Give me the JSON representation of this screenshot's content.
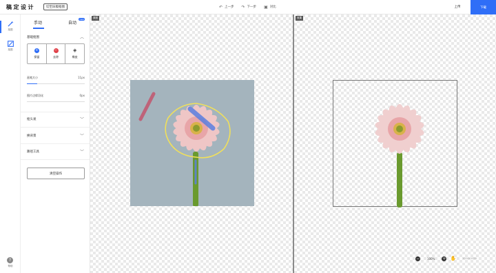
{
  "app": {
    "logo": "稿定设计",
    "switch_label": "切至旧版抠图"
  },
  "toolbar": {
    "undo": "上一步",
    "redo": "下一步",
    "compare": "对比",
    "upload": "上传",
    "download": "下载"
  },
  "rail": [
    {
      "label": "抠图",
      "icon": "magic-wand-icon"
    },
    {
      "label": "抠图",
      "icon": "image-edit-icon"
    }
  ],
  "help": {
    "label": "帮助"
  },
  "panel": {
    "tabs": [
      "手动",
      "自动"
    ],
    "tab_badge": "new",
    "sections": {
      "basic": "基础抠图",
      "head": "抠头发",
      "replace": "换背景",
      "path": "路径工具"
    },
    "brushes": [
      {
        "label": "保留",
        "color": "#2f6ef7",
        "symbol": "+"
      },
      {
        "label": "去除",
        "color": "#e0424a",
        "symbol": "−"
      },
      {
        "label": "橡皮",
        "color": "#333333",
        "symbol": "◈"
      }
    ],
    "brush_size": {
      "label": "画笔大小",
      "value": "11px",
      "fraction": 0.18
    },
    "edge": {
      "label": "图片边缘羽化",
      "value": "0px",
      "fraction": 0
    },
    "clear": "清空操作"
  },
  "canvas": {
    "left_tag": "原图",
    "right_tag": "效果"
  },
  "zoom": {
    "value": "100%",
    "size": "1024×1024"
  },
  "colors": {
    "accent": "#2f6ef7",
    "keep_stroke": "#5b7fe0",
    "remove_stroke": "#c15b72",
    "outline": "#f1e05a"
  }
}
